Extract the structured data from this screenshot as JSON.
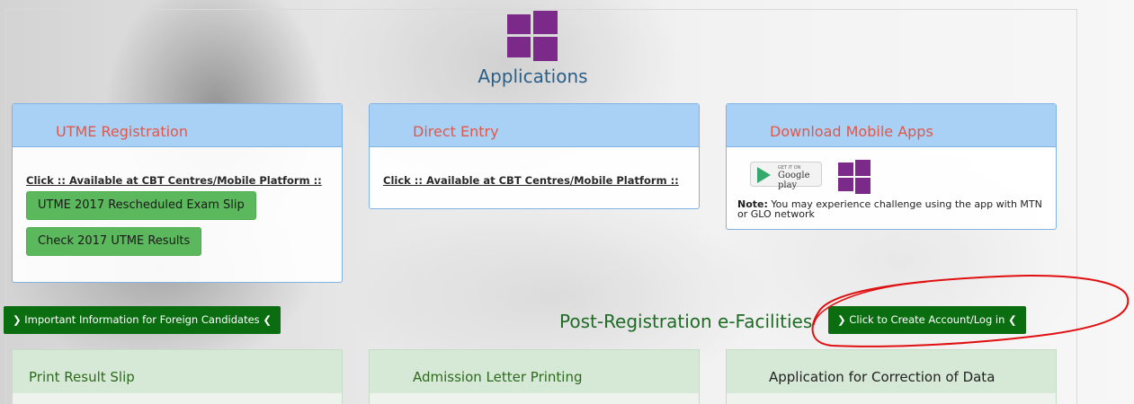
{
  "header": {
    "logo_icon": "windows-icon",
    "title": "Applications"
  },
  "panels": [
    {
      "title": "UTME Registration",
      "link": "Click :: Available at CBT Centres/Mobile Platform ::",
      "buttons": [
        "UTME 2017 Rescheduled Exam Slip",
        "Check 2017 UTME Results"
      ]
    },
    {
      "title": "Direct Entry",
      "link": "Click :: Available at CBT Centres/Mobile Platform ::"
    },
    {
      "title": "Download Mobile Apps",
      "google_play_small": "GET IT ON",
      "google_play_label": "Google play",
      "note_bold": "Note:",
      "note_text": " You may experience challenge using the app with MTN or GLO network"
    }
  ],
  "foreign_button": "❯ Important Information for Foreign Candidates ❮",
  "post_registration": {
    "title": "Post-Registration e-Facilities",
    "login_button": "❯ Click to Create Account/Log in ❮",
    "facilities": [
      "Print Result Slip",
      "Admission Letter Printing",
      "Application for Correction of Data"
    ]
  },
  "colors": {
    "panel_head": "#a9d0f5",
    "panel_title": "#e0584a",
    "green_button": "#5cb85c",
    "dark_green": "#0a6e10",
    "windows_purple": "#7b2a8a",
    "annotation_red": "#e01010"
  }
}
